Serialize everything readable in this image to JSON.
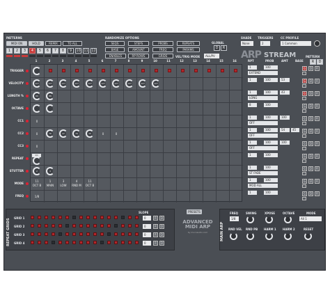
{
  "header": {
    "patterns": "PATTERNS",
    "randomize": "RANDOMIZE OPTIONS",
    "shade": "SHADE",
    "triggers": "TRIGGERS",
    "cc_profile": "CC PROFILE",
    "global": "GLOBAL",
    "pattern": "PATTERN",
    "velo_mode_label": "VEL/TRIG MODE",
    "velo_mode_value": "ALL/PV",
    "shade_value": "None",
    "triggers_value": "2",
    "cc_value": "1 Common"
  },
  "pattern_btns": [
    "MIDI ON",
    "HOLD",
    "REMIX",
    "TO ALL"
  ],
  "pattern_numbers": [
    "1",
    "2",
    "3",
    "4",
    "5",
    "6",
    "7",
    "8",
    "9",
    "10",
    "11",
    "12"
  ],
  "randomize_btns": [
    "SEQS",
    "STEPS",
    "PROBS",
    "REPEATS",
    "BASE",
    "AMOUNT",
    "FREQ",
    "PARAMS",
    "ENABLES",
    "RP ROWS",
    "GRIDS"
  ],
  "brand": {
    "a": "ARP",
    "b": "STREAM"
  },
  "gd": {
    "d": "D",
    "r": "R",
    "g": "G"
  },
  "columns": [
    "1",
    "2",
    "3",
    "4",
    "5",
    "6",
    "7",
    "8",
    "9",
    "10",
    "11",
    "12",
    "13",
    "14",
    "15",
    "16"
  ],
  "right_headers": [
    "RPT",
    "PROB",
    "AMT",
    "BASE"
  ],
  "rows": [
    {
      "label": "TRIGGER",
      "rpt": "1",
      "prob": "100",
      "amt": "",
      "base": "",
      "mode": "EXTEND"
    },
    {
      "label": "VELOCITY",
      "rpt": "1",
      "prob": "100",
      "amt": "53",
      "base": "",
      "mode": ""
    },
    {
      "label": "LENGTH %",
      "rpt": "1",
      "prob": "100",
      "amt": "43",
      "base": "",
      "mode": "LONG"
    },
    {
      "label": "OCTAVE",
      "rpt": "8",
      "prob": "100",
      "amt": "",
      "base": "",
      "mode": ""
    },
    {
      "label": "CC1",
      "rpt": "1",
      "prob": "100",
      "amt": "100",
      "base": "",
      "mode": "OFF"
    },
    {
      "label": "CC2",
      "rpt": "1",
      "prob": "100",
      "amt": "54",
      "base": "45",
      "mode": "OFF"
    },
    {
      "label": "CC3",
      "rpt": "1",
      "prob": "100",
      "amt": "100",
      "base": "",
      "mode": "OFF"
    },
    {
      "label": "REPEAT",
      "rpt": "1",
      "prob": "100",
      "amt": "",
      "base": "",
      "mode": ""
    },
    {
      "label": "STUTTER",
      "rpt": "1",
      "prob": "100",
      "amt": "",
      "base": "",
      "mode": "ST FADE"
    },
    {
      "label": "MODE",
      "rpt": "1",
      "prob": "100",
      "amt": "",
      "base": "",
      "mode": "MOD ALL"
    },
    {
      "label": "FREQ",
      "rpt": "1",
      "prob": "100",
      "amt": "",
      "base": "",
      "mode": ""
    }
  ],
  "cells": {
    "vel": [
      "127",
      "127",
      "127",
      "127",
      "127",
      "127",
      "127",
      "127",
      "127",
      "127"
    ],
    "len": [
      "69",
      "88"
    ],
    "cc1": "0",
    "cc2": [
      "0",
      "76",
      "47",
      "70",
      "15",
      "0",
      "0"
    ],
    "cc3": "0",
    "repeat": "1/1",
    "stutter": [
      "2",
      "4"
    ],
    "mode": [
      "11",
      "1",
      "3",
      "4",
      "11"
    ],
    "mode_sub": [
      "OCT B",
      "MAIN",
      "LOW",
      "RND M",
      "OCT B"
    ],
    "freq": "1/8"
  },
  "bottom": {
    "repeat_grids": "REPEAT GRIDS",
    "slope": "SLOPE",
    "presets": "PRESETS",
    "grid_labels": [
      "GRID 1",
      "GRID 2",
      "GRID 3",
      "GRID 4"
    ],
    "slope_vals": [
      "0",
      "0",
      "0",
      "0"
    ],
    "adv": "ADVANCED",
    "midiarp": "MIDI ARP",
    "by": "by mucoaudio.com",
    "main_arp": "MAIN ARP",
    "freq": "FREQ",
    "freq_val": "1/8",
    "swing": "SWING",
    "xpose": "XPOSE",
    "octave": "OCTAVE",
    "mode": "MODE",
    "mode_val": "All 1",
    "rnd_vel": "RND VEL",
    "rnd_pb": "RND PB",
    "harm1": "HARM 1",
    "harm2": "HARM 2",
    "reset": "RESET"
  },
  "colors": {
    "bg": "#4a4e54",
    "accent_red": "#b2272b"
  }
}
